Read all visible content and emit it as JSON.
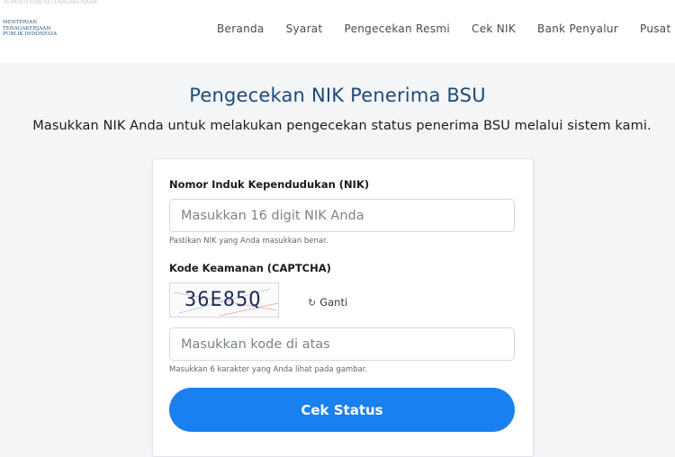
{
  "header": {
    "faint_text": "KEMENTERIAN KETENAGAKERJAAN",
    "logo_lines": [
      "MENTERIAN",
      "TENAGAKERJAAN",
      "PUBLIK INDONESIA"
    ],
    "nav": [
      {
        "label": "Beranda"
      },
      {
        "label": "Syarat"
      },
      {
        "label": "Pengecekan Resmi"
      },
      {
        "label": "Cek NIK"
      },
      {
        "label": "Bank Penyalur"
      },
      {
        "label": "Pusat"
      }
    ]
  },
  "main": {
    "title": "Pengecekan NIK Penerima BSU",
    "subtitle": "Masukkan NIK Anda untuk melakukan pengecekan status penerima BSU melalui sistem kami."
  },
  "form": {
    "nik_label": "Nomor Induk Kependudukan (NIK)",
    "nik_placeholder": "Masukkan 16 digit NIK Anda",
    "nik_value": "",
    "nik_hint": "Pastikan NIK yang Anda masukkan benar.",
    "captcha_label": "Kode Keamanan (CAPTCHA)",
    "captcha_code": "36E85Q",
    "refresh_label": "Ganti",
    "refresh_icon": "refresh-icon",
    "captcha_placeholder": "Masukkan kode di atas",
    "captcha_value": "",
    "captcha_hint": "Masukkan 6 karakter yang Anda lihat pada gambar.",
    "submit_label": "Cek Status"
  },
  "colors": {
    "accent": "#1a7ff0",
    "title": "#1e4a7a",
    "background": "#f4f5f7"
  }
}
